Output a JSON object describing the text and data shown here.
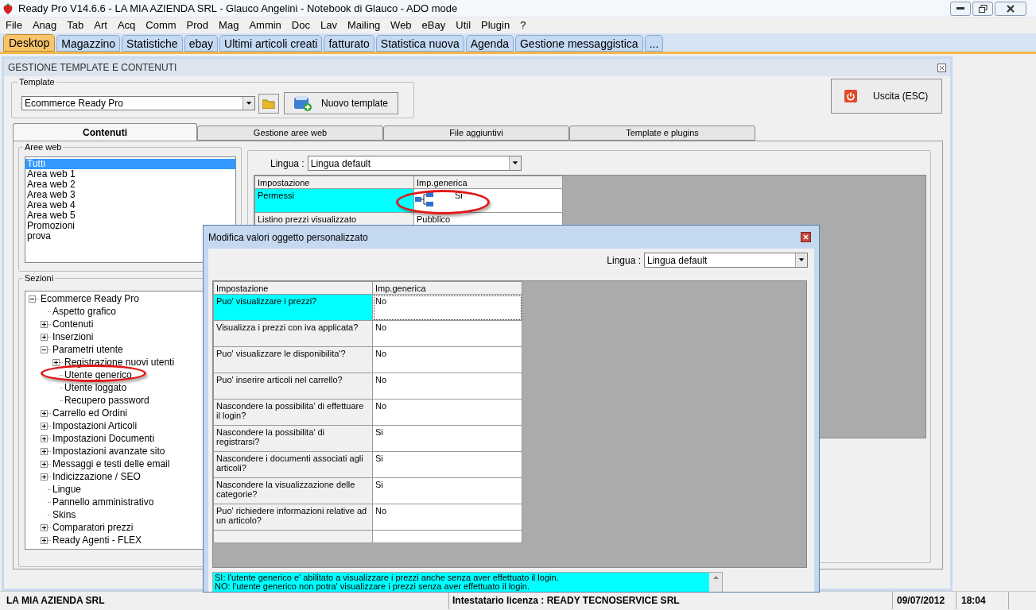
{
  "window": {
    "title": "Ready Pro V14.6.6 - LA MIA AZIENDA SRL - Glauco Angelini - Notebook di Glauco - ADO mode"
  },
  "menu": [
    "File",
    "Anag",
    "Tab",
    "Art",
    "Acq",
    "Comm",
    "Prod",
    "Mag",
    "Ammin",
    "Doc",
    "Lav",
    "Mailing",
    "Web",
    "eBay",
    "Util",
    "Plugin",
    "?"
  ],
  "tabs": [
    {
      "label": "Desktop",
      "selected": true
    },
    {
      "label": "Magazzino",
      "selected": false
    },
    {
      "label": "Statistiche",
      "selected": false
    },
    {
      "label": "ebay",
      "selected": false
    },
    {
      "label": "Ultimi articoli creati",
      "selected": false
    },
    {
      "label": "fatturato",
      "selected": false
    },
    {
      "label": "Statistica nuova",
      "selected": false
    },
    {
      "label": "Agenda",
      "selected": false
    },
    {
      "label": "Gestione messaggistica",
      "selected": false
    },
    {
      "label": "...",
      "selected": false
    }
  ],
  "panel": {
    "title": "GESTIONE TEMPLATE E CONTENUTI",
    "template": {
      "label": "Template",
      "value": "Ecommerce Ready Pro",
      "new_button": "Nuovo template"
    },
    "exit_button": "Uscita (ESC)",
    "tabs": [
      {
        "label": "Contenuti",
        "selected": true
      },
      {
        "label": "Gestione aree web",
        "selected": false
      },
      {
        "label": "File aggiuntivi",
        "selected": false
      },
      {
        "label": "Template e plugins",
        "selected": false
      }
    ],
    "aree_web": {
      "label": "Aree web",
      "items": [
        {
          "label": "Tutti",
          "selected": true
        },
        {
          "label": "Area web 1",
          "selected": false
        },
        {
          "label": "Area web 2",
          "selected": false
        },
        {
          "label": "Area web 3",
          "selected": false
        },
        {
          "label": "Area web 4",
          "selected": false
        },
        {
          "label": "Area web 5",
          "selected": false
        },
        {
          "label": "Promozioni",
          "selected": false
        },
        {
          "label": "prova",
          "selected": false
        }
      ]
    },
    "sezioni": {
      "label": "Sezioni",
      "tree": [
        {
          "label": "Ecommerce Ready Pro",
          "expanded": true,
          "children": [
            {
              "label": "Aspetto grafico"
            },
            {
              "label": "Contenuti",
              "expanded": false
            },
            {
              "label": "Inserzioni",
              "expanded": false
            },
            {
              "label": "Parametri utente",
              "expanded": true,
              "children": [
                {
                  "label": "Registrazione nuovi utenti",
                  "expanded": false
                },
                {
                  "label": "Utente generico"
                },
                {
                  "label": "Utente loggato"
                },
                {
                  "label": "Recupero password"
                }
              ]
            },
            {
              "label": "Carrello ed Ordini",
              "expanded": false
            },
            {
              "label": "Impostazioni Articoli",
              "expanded": false
            },
            {
              "label": "Impostazioni Documenti",
              "expanded": false
            },
            {
              "label": "Impostazioni avanzate sito",
              "expanded": false
            },
            {
              "label": "Messaggi e testi delle email",
              "expanded": false
            },
            {
              "label": "Indicizzazione / SEO",
              "expanded": false
            },
            {
              "label": "Lingue"
            },
            {
              "label": "Pannello amministrativo"
            },
            {
              "label": "Skins"
            },
            {
              "label": "Comparatori prezzi",
              "expanded": false
            },
            {
              "label": "Ready Agenti - FLEX",
              "expanded": false
            }
          ]
        }
      ]
    },
    "lingua": {
      "label": "Lingua :",
      "value": "Lingua default"
    },
    "grid": {
      "columns": [
        "Impostazione",
        "Imp.generica"
      ],
      "rows": [
        {
          "setting": "Permessi",
          "value": "Si",
          "kind": "tree",
          "selected": true
        },
        {
          "setting": "Listino prezzi visualizzato",
          "value": "Pubblico",
          "kind": "text",
          "selected": false
        }
      ]
    }
  },
  "dialog": {
    "title": "Modifica valori oggetto personalizzato",
    "lingua": {
      "label": "Lingua :",
      "value": "Lingua default"
    },
    "grid": {
      "columns": [
        "Impostazione",
        "Imp.generica"
      ],
      "rows": [
        {
          "setting": "Puo' visualizzare i prezzi?",
          "value": "No",
          "selected": true
        },
        {
          "setting": "Visualizza i prezzi con iva applicata?",
          "value": "No",
          "selected": false
        },
        {
          "setting": "Puo' visualizzare le disponibilita'?",
          "value": "No",
          "selected": false
        },
        {
          "setting": "Puo' inserire articoli nel carrello?",
          "value": "No",
          "selected": false
        },
        {
          "setting": "Nascondere la possibilita' di effettuare il login?",
          "value": "No",
          "selected": false
        },
        {
          "setting": "Nascondere la possibilita' di registrarsi?",
          "value": "Si",
          "selected": false
        },
        {
          "setting": "Nascondere i documenti associati agli articoli?",
          "value": "Si",
          "selected": false
        },
        {
          "setting": "Nascondere la visualizzazione delle categorie?",
          "value": "Si",
          "selected": false
        },
        {
          "setting": "Puo' richiedere informazioni relative ad un articolo?",
          "value": "No",
          "selected": false
        }
      ]
    },
    "help": [
      "SI: l'utente generico e' abilitato a visualizzare i prezzi anche senza aver effettuato il login.",
      "NO: l'utente generico non potra' visualizzare i prezzi senza aver effettuato il login."
    ]
  },
  "status_bar": [
    "LA MIA AZIENDA SRL",
    "Intestatario licenza : READY TECNOSERVICE SRL",
    "09/07/2012",
    "18:04"
  ]
}
